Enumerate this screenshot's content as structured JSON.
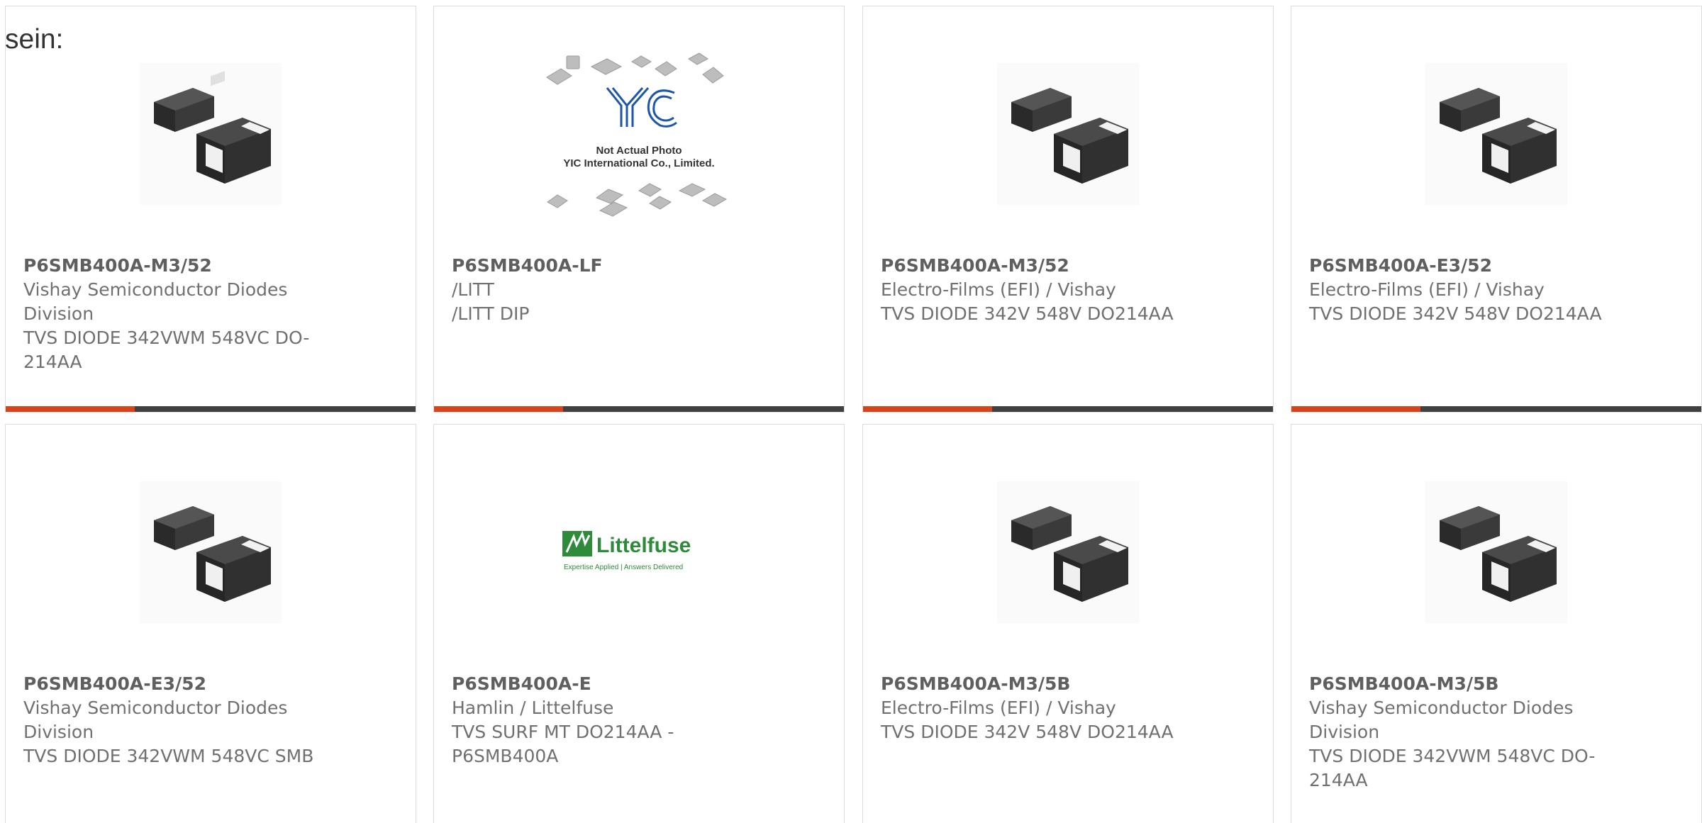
{
  "intro": "sein:",
  "colors": {
    "accent": "#d8431a",
    "bar": "#404040",
    "border": "#dcdcdc",
    "text": "#707070"
  },
  "products": [
    {
      "part": "P6SMB400A-M3/52",
      "lines": [
        "Vishay Semiconductor Diodes",
        "Division",
        "TVS DIODE 342VWM 548VC DO-",
        "214AA"
      ],
      "image": "smb-package-icon"
    },
    {
      "part": "P6SMB400A-LF",
      "lines": [
        "/LITT",
        "/LITT DIP",
        "",
        ""
      ],
      "image": "not-actual-photo-placeholder",
      "placeholder_text": [
        "Not Actual Photo",
        "YIC International Co., Limited."
      ],
      "placeholder_logo": "YIC"
    },
    {
      "part": "P6SMB400A-M3/52",
      "lines": [
        "Electro-Films (EFI) / Vishay",
        "TVS DIODE 342V 548V DO214AA",
        "",
        ""
      ],
      "image": "smb-package-icon"
    },
    {
      "part": "P6SMB400A-E3/52",
      "lines": [
        "Electro-Films (EFI) / Vishay",
        "TVS DIODE 342V 548V DO214AA",
        "",
        ""
      ],
      "image": "smb-package-icon"
    },
    {
      "part": "P6SMB400A-E3/52",
      "lines": [
        "Vishay Semiconductor Diodes",
        "Division",
        "TVS DIODE 342VWM 548VC SMB",
        ""
      ],
      "image": "smb-package-icon"
    },
    {
      "part": "P6SMB400A-E",
      "lines": [
        "Hamlin / Littelfuse",
        "TVS SURF MT DO214AA -",
        "P6SMB400A",
        ""
      ],
      "image": "littelfuse-logo",
      "logo_text": "Littelfuse",
      "logo_tagline": "Expertise Applied | Answers Delivered"
    },
    {
      "part": "P6SMB400A-M3/5B",
      "lines": [
        "Electro-Films (EFI) / Vishay",
        "TVS DIODE 342V 548V DO214AA",
        "",
        ""
      ],
      "image": "smb-package-icon"
    },
    {
      "part": "P6SMB400A-M3/5B",
      "lines": [
        "Vishay Semiconductor Diodes",
        "Division",
        "TVS DIODE 342VWM 548VC DO-",
        "214AA"
      ],
      "image": "smb-package-icon"
    }
  ]
}
